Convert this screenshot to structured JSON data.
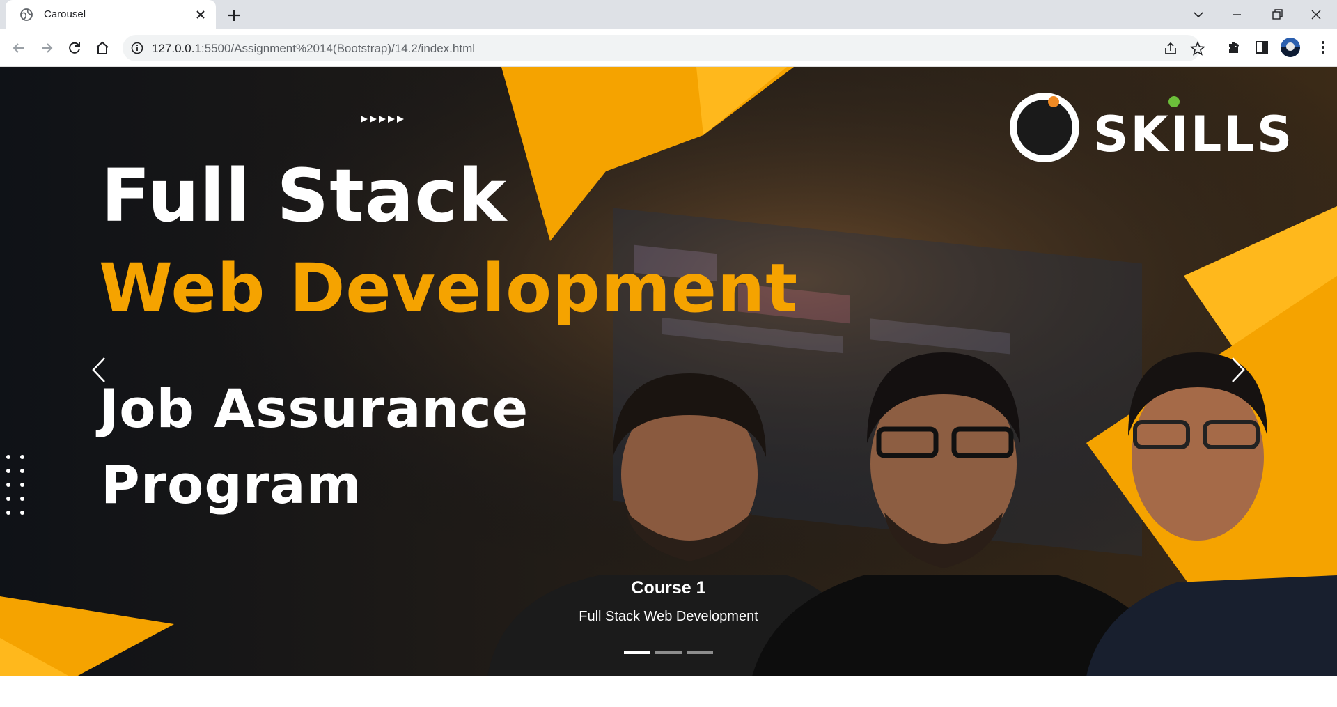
{
  "browser": {
    "tab": {
      "title": "Carousel",
      "favicon": "globe-icon",
      "close_icon": "close-icon"
    },
    "new_tab_icon": "plus-icon",
    "window_controls": [
      "chevron-down-icon",
      "minimize-icon",
      "restore-icon",
      "close-icon"
    ],
    "nav": [
      "back-arrow-icon",
      "forward-arrow-icon",
      "reload-icon",
      "home-icon"
    ],
    "address": {
      "host": "127.0.0.1",
      "path": ":5500/Assignment%2014(Bootstrap)/14.2/index.html"
    },
    "toolbar_icons": [
      "share-icon",
      "star-icon",
      "extensions-icon",
      "sidepanel-icon",
      "avatar",
      "more-icon"
    ]
  },
  "carousel": {
    "banner": {
      "line1": "Full Stack",
      "line2": "Web Development",
      "line3": "Job Assurance",
      "line4": "Program",
      "logo": "SKILLS"
    },
    "caption": {
      "title": "Course 1",
      "text": "Full Stack Web Development"
    },
    "indicators": [
      true,
      false,
      false
    ],
    "controls": {
      "prev_icon": "chevron-left-icon",
      "next_icon": "chevron-right-icon"
    },
    "colors": {
      "accent": "#f5a300",
      "background": "#0f1217"
    }
  }
}
